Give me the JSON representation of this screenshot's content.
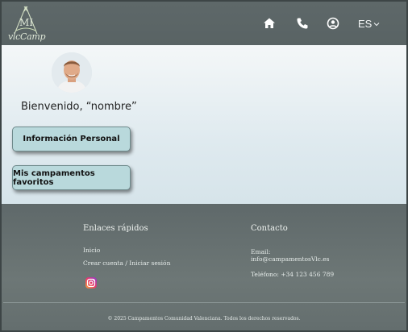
{
  "header": {
    "logo_text": "vlcCamp",
    "logo_letters": "MI",
    "nav": {
      "home_icon": "home-icon",
      "phone_icon": "phone-icon",
      "account_icon": "user-circle-icon",
      "language": "ES"
    }
  },
  "main": {
    "welcome": "Bienvenido, “nombre”",
    "buttons": {
      "personal_info": "Información Personal",
      "favorite_camps": "Mis campamentos favoritos"
    }
  },
  "footer": {
    "quick_links": {
      "title": "Enlaces rápidos",
      "items": [
        "Inicio",
        "Crear cuenta / Iniciar sesión"
      ],
      "social_icon": "instagram-icon"
    },
    "contact": {
      "title": "Contacto",
      "email_label": "Email:",
      "email": "info@campamentosVlc.es",
      "phone": "Teléfono: +34 123 456 789"
    },
    "copyright": "© 2025 Campamentos Comunidad Valenciana. Todos los derechos reservados."
  },
  "colors": {
    "header_bg": "#5b6566",
    "button_bg": "#b9d9dc",
    "footer_bg": "#6a7474"
  }
}
